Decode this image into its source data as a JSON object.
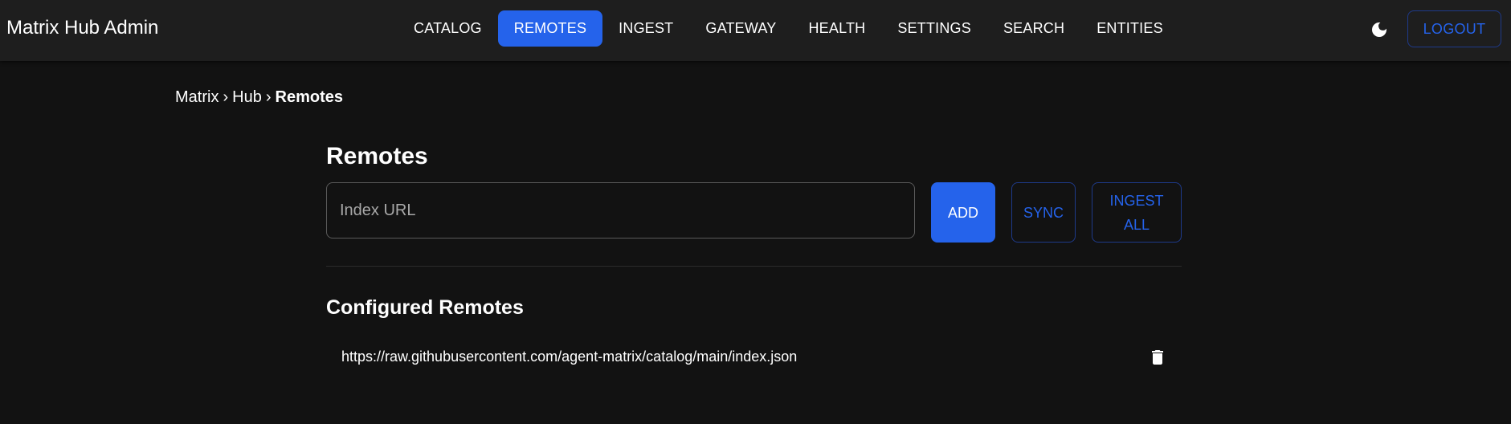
{
  "app": {
    "title": "Matrix Hub Admin"
  },
  "nav": {
    "items": [
      {
        "label": "CATALOG",
        "active": false
      },
      {
        "label": "REMOTES",
        "active": true
      },
      {
        "label": "INGEST",
        "active": false
      },
      {
        "label": "GATEWAY",
        "active": false
      },
      {
        "label": "HEALTH",
        "active": false
      },
      {
        "label": "SETTINGS",
        "active": false
      },
      {
        "label": "SEARCH",
        "active": false
      },
      {
        "label": "ENTITIES",
        "active": false
      }
    ],
    "theme_icon": "moon-icon",
    "logout_label": "LOGOUT"
  },
  "breadcrumb": {
    "items": [
      "Matrix",
      "Hub",
      "Remotes"
    ],
    "separator": "›"
  },
  "main": {
    "title": "Remotes",
    "url_input": {
      "placeholder": "Index URL",
      "value": ""
    },
    "buttons": {
      "add": "ADD",
      "sync": "SYNC",
      "ingest_all_line1": "INGEST",
      "ingest_all_line2": "ALL"
    },
    "section_title": "Configured Remotes",
    "remotes": [
      {
        "url": "https://raw.githubusercontent.com/agent-matrix/catalog/main/index.json",
        "icon": "trash-icon"
      }
    ]
  },
  "colors": {
    "accent": "#2563eb",
    "appbar": "#1e1e1e",
    "background": "#121212",
    "outline": "#1e3a8a"
  }
}
